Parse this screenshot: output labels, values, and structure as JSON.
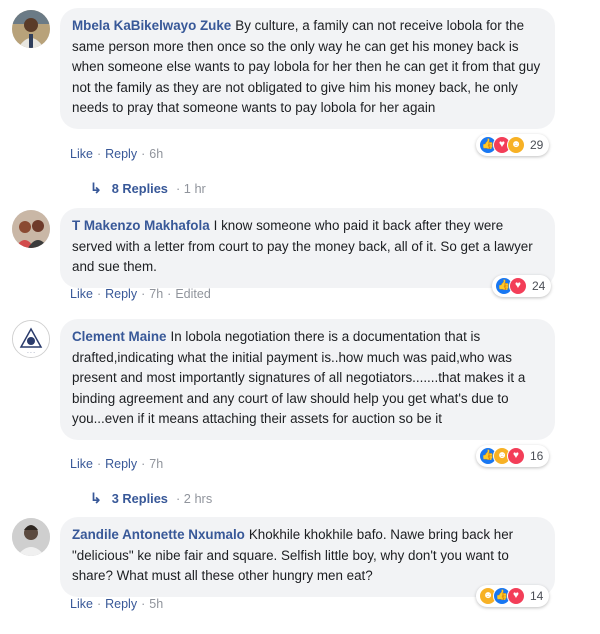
{
  "comments": [
    {
      "author": "Mbela KaBikelwayo Zuke",
      "text": "By culture, a family can not receive lobola for the same person more then once so the only way he can get his money back is when someone else wants to pay lobola for her then he can get it from that guy not the family as they are not obligated to give him his money back, he only needs to pray that someone wants to pay lobola for her again",
      "like_label": "Like",
      "reply_label": "Reply",
      "time": "6h",
      "reaction_count": "29",
      "reactions": [
        "like",
        "love",
        "haha"
      ],
      "replies_label": "8 Replies",
      "replies_time": "1 hr"
    },
    {
      "author": "T Makenzo Makhafola",
      "text": "I know someone who paid it back after they were served with a letter from court to pay the money back, all of it. So get a lawyer and sue them.",
      "like_label": "Like",
      "reply_label": "Reply",
      "time": "7h",
      "edited_label": "Edited",
      "reaction_count": "24",
      "reactions": [
        "like",
        "love"
      ]
    },
    {
      "author": "Clement Maine",
      "text": "In lobola negotiation there is a documentation that is drafted,indicating what the initial payment is..how much was paid,who was present and most importantly signatures of all negotiators.......that makes it a binding agreement and any court of law should help you get what's due to you...even if it means attaching their assets for auction so be it",
      "like_label": "Like",
      "reply_label": "Reply",
      "time": "7h",
      "reaction_count": "16",
      "reactions": [
        "like",
        "haha",
        "love"
      ],
      "replies_label": "3 Replies",
      "replies_time": "2 hrs"
    },
    {
      "author": "Zandile Antonette Nxumalo",
      "text": "Khokhile khokhile bafo. Nawe bring back her \"delicious\" ke nibe fair and square. Selfish little boy, why don't you want to share? What must all these other hungry men eat?",
      "like_label": "Like",
      "reply_label": "Reply",
      "time": "5h",
      "reaction_count": "14",
      "reactions": [
        "haha",
        "like",
        "love"
      ]
    }
  ],
  "colors": {
    "link": "#385898",
    "bubble": "#f2f3f5",
    "meta": "#90949c",
    "like": "#1877f2",
    "love": "#f33e58",
    "haha": "#f7b125"
  }
}
